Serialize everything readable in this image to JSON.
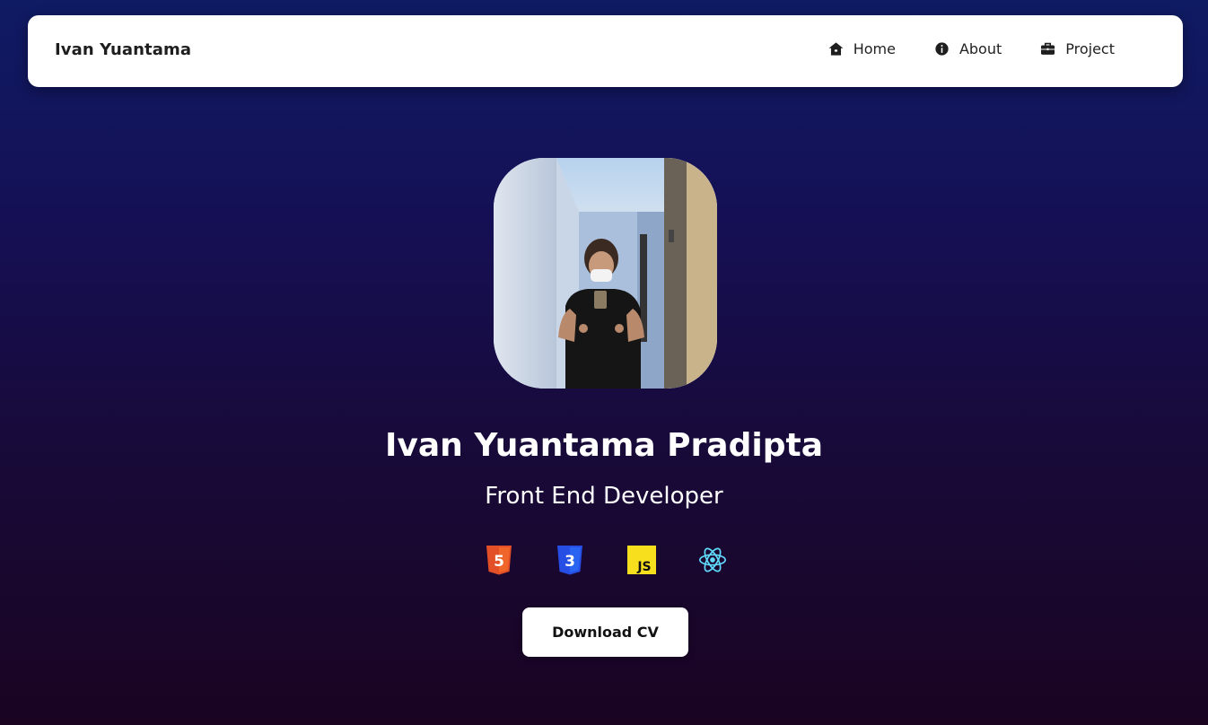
{
  "nav": {
    "brand": "Ivan Yuantama",
    "links": [
      {
        "label": "Home",
        "icon": "home-icon"
      },
      {
        "label": "About",
        "icon": "info-icon"
      },
      {
        "label": "Project",
        "icon": "briefcase-icon"
      }
    ]
  },
  "hero": {
    "name": "Ivan Yuantama Pradipta",
    "role": "Front End Developer",
    "tech": [
      {
        "name": "html5-icon",
        "label": "5",
        "color": "#e34f26"
      },
      {
        "name": "css3-icon",
        "label": "3",
        "color": "#2965f1"
      },
      {
        "name": "javascript-icon",
        "label": "JS",
        "color": "#f7df1e"
      },
      {
        "name": "react-icon",
        "label": "",
        "color": "#61dafb"
      }
    ],
    "cta": "Download CV"
  },
  "colors": {
    "background_top": "#0f1b63",
    "background_bottom": "#1a0422",
    "surface": "#ffffff"
  }
}
